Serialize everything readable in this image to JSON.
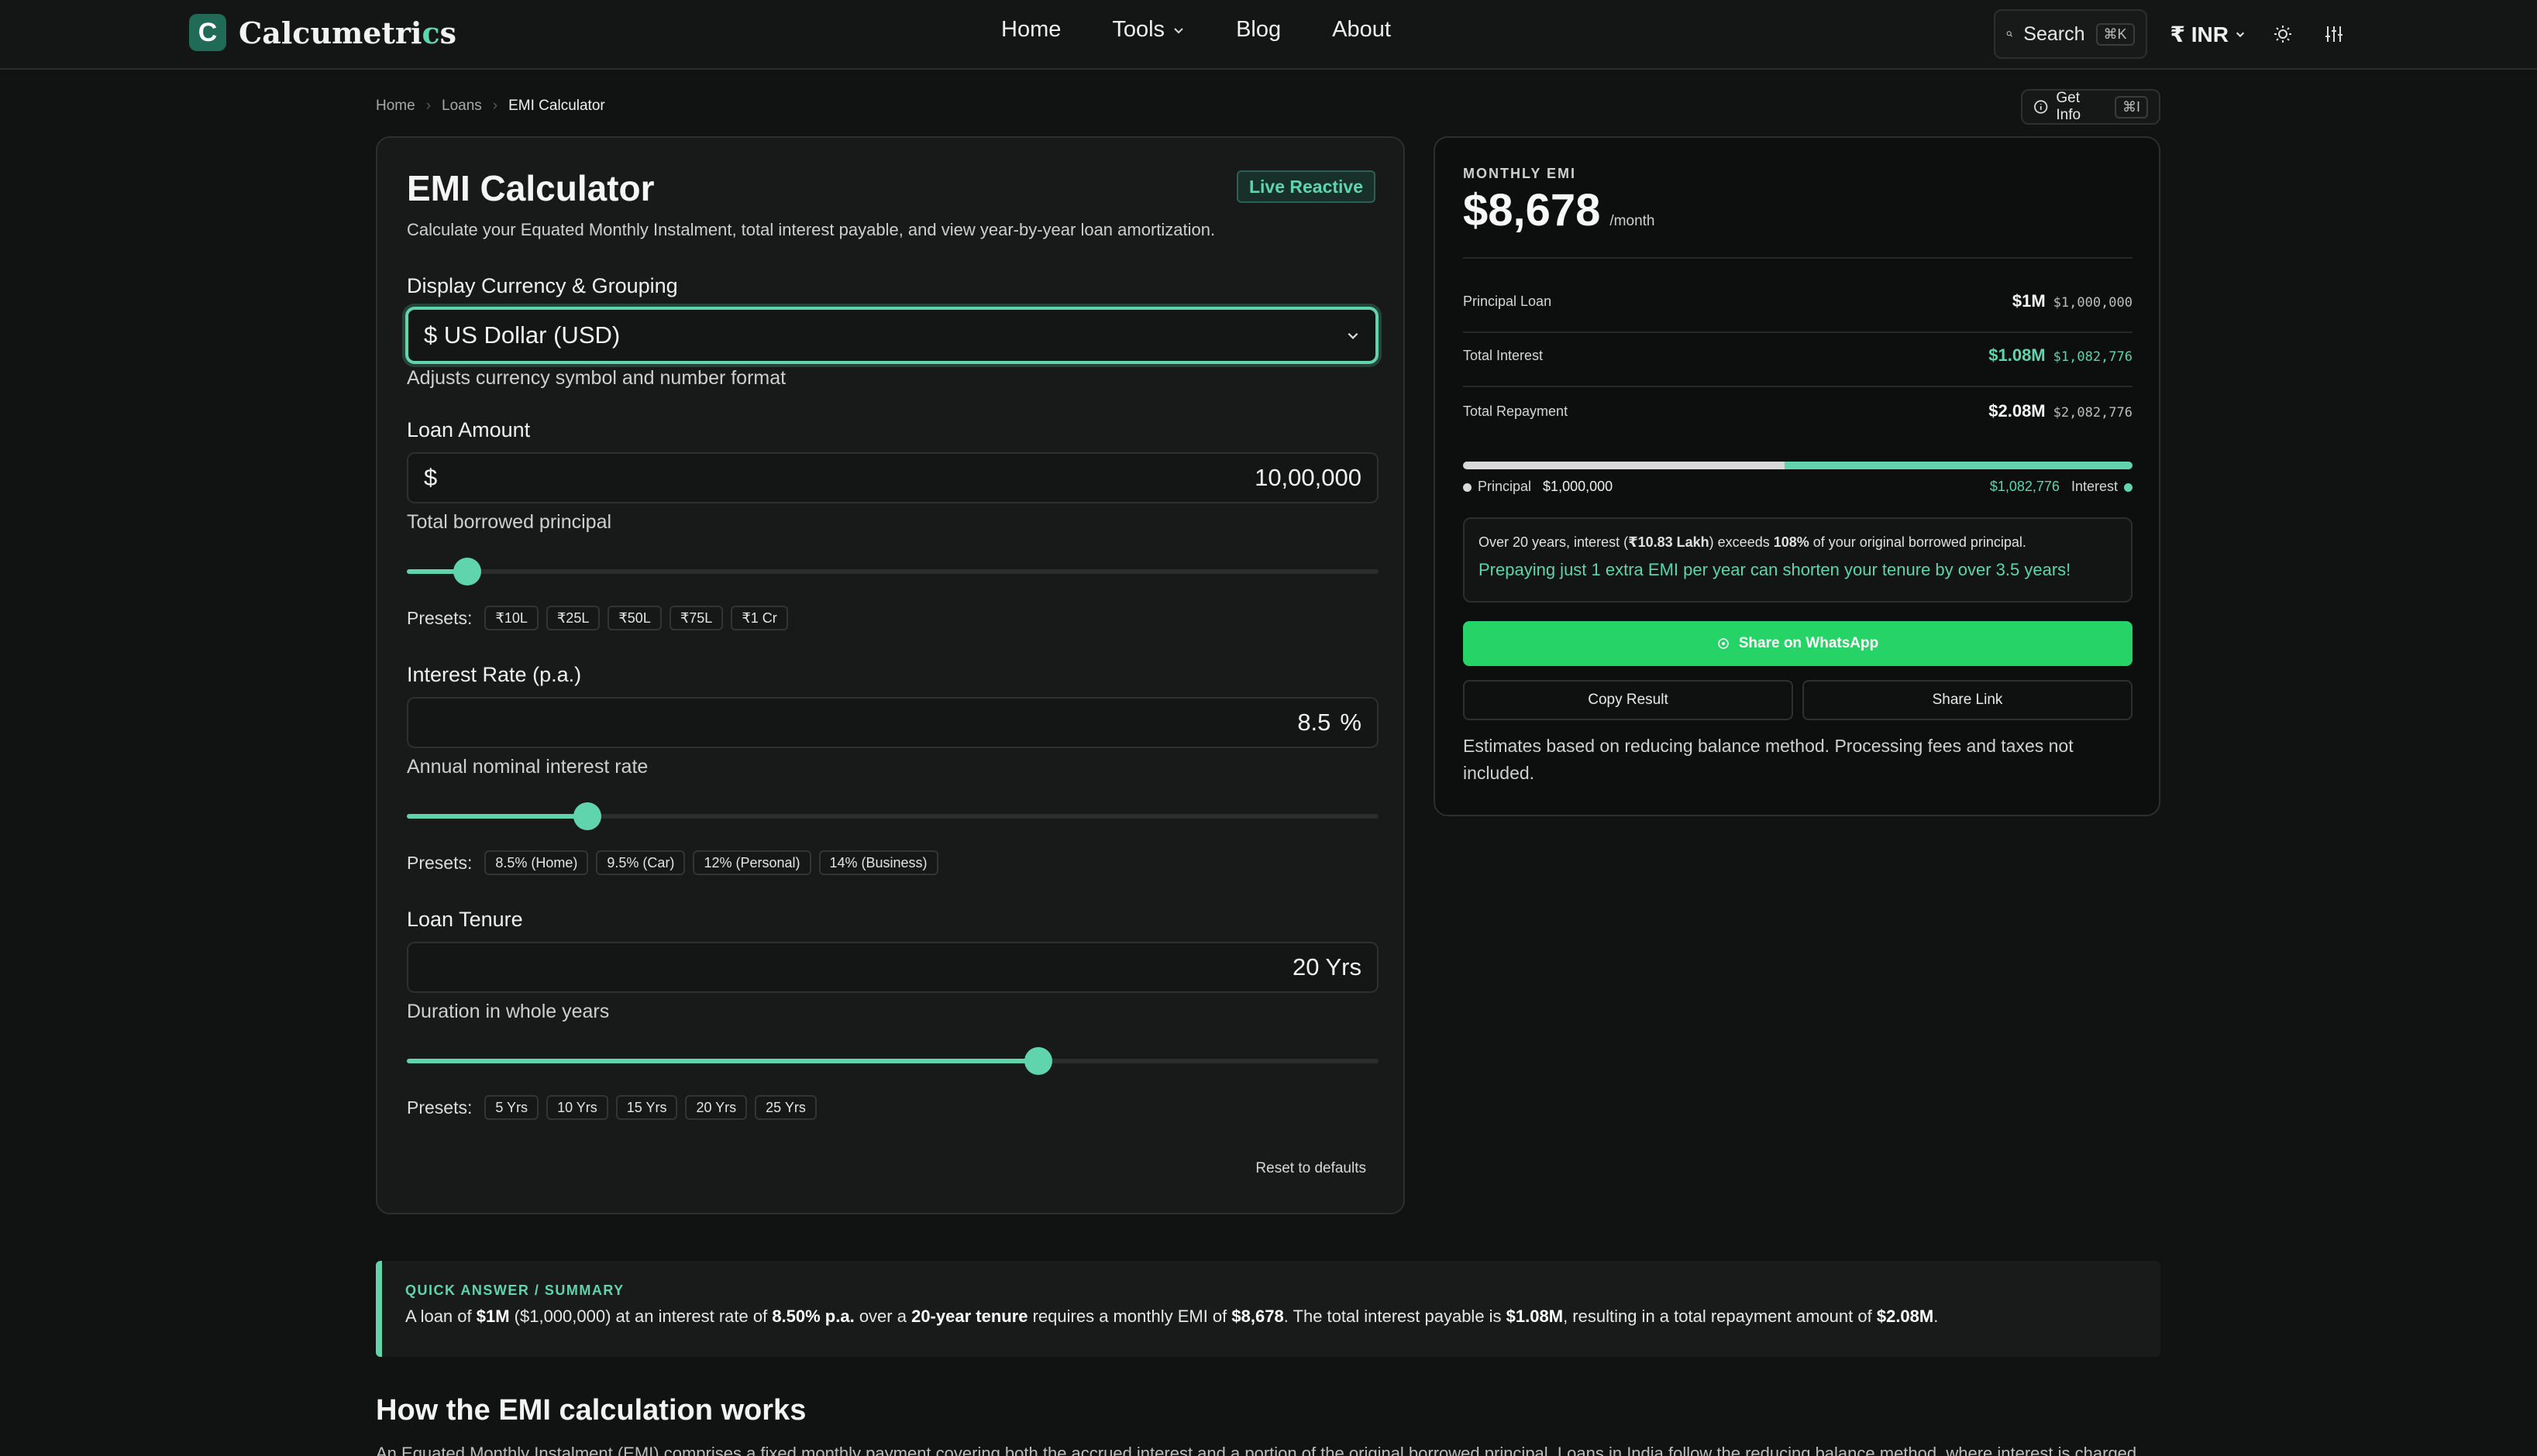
{
  "header": {
    "logo_letter": "C",
    "brand_main": "Calcumetri",
    "brand_accent": "c",
    "brand_end": "s",
    "nav": [
      "Home",
      "Tools",
      "Blog",
      "About"
    ],
    "search_label": "Search",
    "search_shortcut": "⌘K",
    "currency": "₹ INR"
  },
  "breadcrumb": [
    "Home",
    "Loans",
    "EMI Calculator"
  ],
  "get_info": {
    "label": "Get Info",
    "shortcut": "⌘I"
  },
  "calculator": {
    "title": "EMI Calculator",
    "badge": "Live Reactive",
    "subtitle": "Calculate your Equated Monthly Instalment, total interest payable, and view year-by-year loan amortization.",
    "currency_field": {
      "label": "Display Currency & Grouping",
      "value": "$ US Dollar (USD)",
      "help": "Adjusts currency symbol and number format"
    },
    "loan_amount": {
      "label": "Loan Amount",
      "prefix": "$",
      "value": "10,00,000",
      "help": "Total borrowed principal",
      "slider_fraction": 0.062,
      "presets_label": "Presets:",
      "presets": [
        "₹10L",
        "₹25L",
        "₹50L",
        "₹75L",
        "₹1 Cr"
      ]
    },
    "interest_rate": {
      "label": "Interest Rate (p.a.)",
      "value": "8.5",
      "suffix": "%",
      "help": "Annual nominal interest rate",
      "slider_fraction": 0.186,
      "presets_label": "Presets:",
      "presets": [
        "8.5% (Home)",
        "9.5% (Car)",
        "12% (Personal)",
        "14% (Business)"
      ]
    },
    "tenure": {
      "label": "Loan Tenure",
      "value": "20 Yrs",
      "help": "Duration in whole years",
      "slider_fraction": 0.65,
      "presets_label": "Presets:",
      "presets": [
        "5 Yrs",
        "10 Yrs",
        "15 Yrs",
        "20 Yrs",
        "25 Yrs"
      ]
    },
    "reset_label": "Reset to defaults"
  },
  "result": {
    "emi_label": "MONTHLY EMI",
    "emi_value": "$8,678",
    "emi_unit": "/month",
    "rows": [
      {
        "label": "Principal Loan",
        "short": "$1M",
        "full": "$1,000,000",
        "highlight": false
      },
      {
        "label": "Total Interest",
        "short": "$1.08M",
        "full": "$1,082,776",
        "highlight": true
      },
      {
        "label": "Total Repayment",
        "short": "$2.08M",
        "full": "$2,082,776",
        "highlight": false
      }
    ],
    "principal_fraction": 0.48,
    "legend": {
      "principal_label": "Principal",
      "principal_value": "$1,000,000",
      "interest_value": "$1,082,776",
      "interest_label": "Interest"
    },
    "insight_pre": "Over 20 years, interest (",
    "insight_amount": "₹10.83 Lakh",
    "insight_mid": ") exceeds ",
    "insight_pct": "108%",
    "insight_post": " of your original borrowed principal.",
    "insight_tip": "Prepaying just 1 extra EMI per year can shorten your tenure by over 3.5 years!",
    "whatsapp_label": "Share on WhatsApp",
    "copy_label": "Copy Result",
    "share_label": "Share Link",
    "disclaimer": "Estimates based on reducing balance method. Processing fees and taxes not included."
  },
  "quick_answer": {
    "label": "QUICK ANSWER / SUMMARY",
    "t1": "A loan of ",
    "b1": "$1M",
    "t2": " ($1,000,000) at an interest rate of ",
    "b2": "8.50% p.a.",
    "t3": " over a ",
    "b3": "20-year tenure",
    "t4": " requires a monthly EMI of ",
    "b4": "$8,678",
    "t5": ". The total interest payable is ",
    "b5": "$1.08M",
    "t6": ", resulting in a total repayment amount of ",
    "b6": "$2.08M",
    "t7": "."
  },
  "how_it_works": {
    "title": "How the EMI calculation works",
    "paragraph": "An Equated Monthly Instalment (EMI) comprises a fixed monthly payment covering both the accrued interest and a portion of the original borrowed principal. Loans in India follow the reducing balance method, where interest is charged"
  },
  "colors": {
    "accent": "#5fd4ad",
    "whatsapp": "#25d366",
    "background": "#111212"
  }
}
